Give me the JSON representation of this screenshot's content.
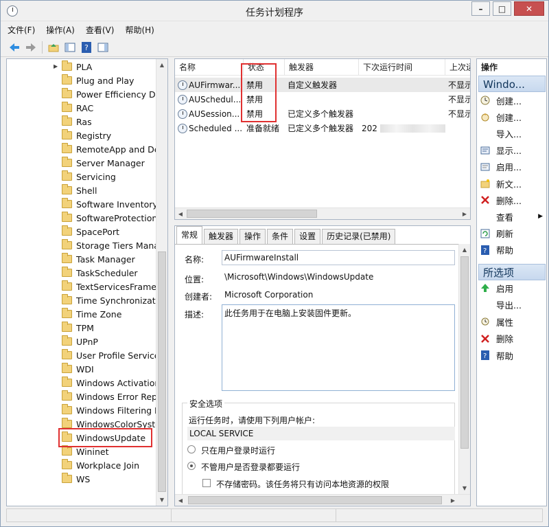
{
  "title": "任务计划程序",
  "menu": [
    "文件(F)",
    "操作(A)",
    "查看(V)",
    "帮助(H)"
  ],
  "tree": [
    "PLA",
    "Plug and Play",
    "Power Efficiency Dia",
    "RAC",
    "Ras",
    "Registry",
    "RemoteApp and De",
    "Server Manager",
    "Servicing",
    "Shell",
    "Software Inventory L",
    "SoftwareProtectionP",
    "SpacePort",
    "Storage Tiers Mana",
    "Task Manager",
    "TaskScheduler",
    "TextServicesFramew",
    "Time Synchronizatio",
    "Time Zone",
    "TPM",
    "UPnP",
    "User Profile Service",
    "WDI",
    "Windows Activation",
    "Windows Error Repo",
    "Windows Filtering Pl",
    "WindowsColorSyste",
    "WindowsUpdate",
    "Wininet",
    "Workplace Join",
    "WS"
  ],
  "columns": [
    "名称",
    "状态",
    "触发器",
    "下次运行时间",
    "上次运"
  ],
  "tasks": [
    {
      "name": "AUFirmwar...",
      "status": "禁用",
      "trigger": "自定义触发器",
      "next": "",
      "last": "不显示"
    },
    {
      "name": "AUSchedul...",
      "status": "禁用",
      "trigger": "",
      "next": "",
      "last": "不显示"
    },
    {
      "name": "AUSession...",
      "status": "禁用",
      "trigger": "已定义多个触发器",
      "next": "",
      "last": "不显示"
    },
    {
      "name": "Scheduled ...",
      "status": "准备就绪",
      "trigger": "已定义多个触发器",
      "next": "202",
      "last": ""
    }
  ],
  "tabs": [
    "常规",
    "触发器",
    "操作",
    "条件",
    "设置",
    "历史记录(已禁用)"
  ],
  "general": {
    "name_label": "名称:",
    "name_value": "AUFirmwareInstall",
    "location_label": "位置:",
    "location_value": "\\Microsoft\\Windows\\WindowsUpdate",
    "author_label": "创建者:",
    "author_value": "Microsoft Corporation",
    "desc_label": "描述:",
    "desc_value": "此任务用于在电脑上安装固件更新。",
    "security_title": "安全选项",
    "run_as_prompt": "运行任务时，请使用下列用户帐户:",
    "account": "LOCAL SERVICE",
    "radio1": "只在用户登录时运行",
    "radio2": "不管用户是否登录都要运行",
    "checkbox1": "不存储密码。该任务将只有访问本地资源的权限"
  },
  "actions": {
    "header": "操作",
    "group1": "Windo...",
    "items1": [
      "创建...",
      "创建...",
      "导入...",
      "显示...",
      "启用...",
      "新文...",
      "删除...",
      "查看",
      "刷新",
      "帮助"
    ],
    "group2": "所选项",
    "items2": [
      "启用",
      "导出...",
      "属性",
      "删除",
      "帮助"
    ]
  },
  "colors": {
    "highlight": "#e03030",
    "group_bg": "#dbe7f5"
  }
}
